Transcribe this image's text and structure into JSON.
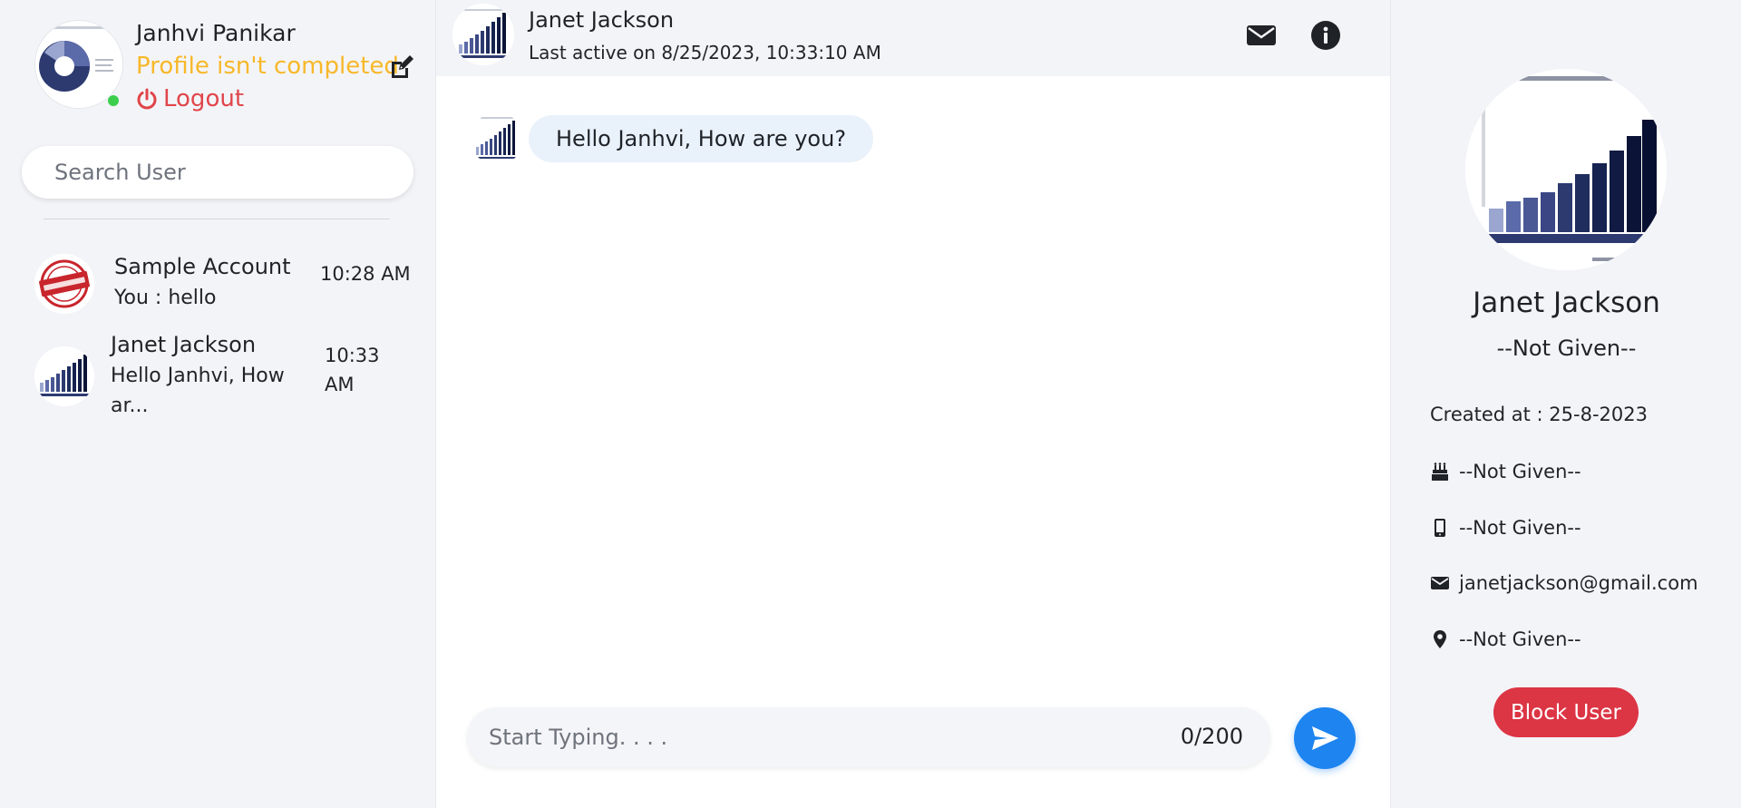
{
  "current_user": {
    "name": "Janhvi Panikar",
    "profile_status": "Profile isn't completed",
    "logout_label": "Logout",
    "online": true
  },
  "search": {
    "placeholder": "Search User"
  },
  "conversations": [
    {
      "name": "Sample Account",
      "last_message": "You : hello",
      "time": "10:28 AM",
      "avatar": "sample-stamp"
    },
    {
      "name": "Janet Jackson",
      "last_message": "Hello Janhvi, How ar...",
      "time": "10:33 AM",
      "avatar": "bar-chart-thumbnail"
    }
  ],
  "chat_header": {
    "name": "Janet Jackson",
    "last_active": "Last active on 8/25/2023, 10:33:10 AM",
    "icons": [
      "envelope-icon",
      "info-icon"
    ]
  },
  "messages": [
    {
      "from": "Janet Jackson",
      "text": "Hello Janhvi, How are you?"
    }
  ],
  "composer": {
    "placeholder": "Start Typing. . . .",
    "counter": "0/200"
  },
  "profile": {
    "name": "Janet Jackson",
    "about": "--Not Given--",
    "created": "Created at : 25-8-2023",
    "birthday": "--Not Given--",
    "phone": "--Not Given--",
    "email": "janetjackson@gmail.com",
    "location": "--Not Given--",
    "block_label": "Block User"
  },
  "colors": {
    "accent": "#1d84f0",
    "warning": "#f7b829",
    "danger": "#dc3544",
    "logout": "#e0454a",
    "online": "#3ccf4e",
    "bubble": "#e9f1fb",
    "panel": "#f3f4f8"
  }
}
